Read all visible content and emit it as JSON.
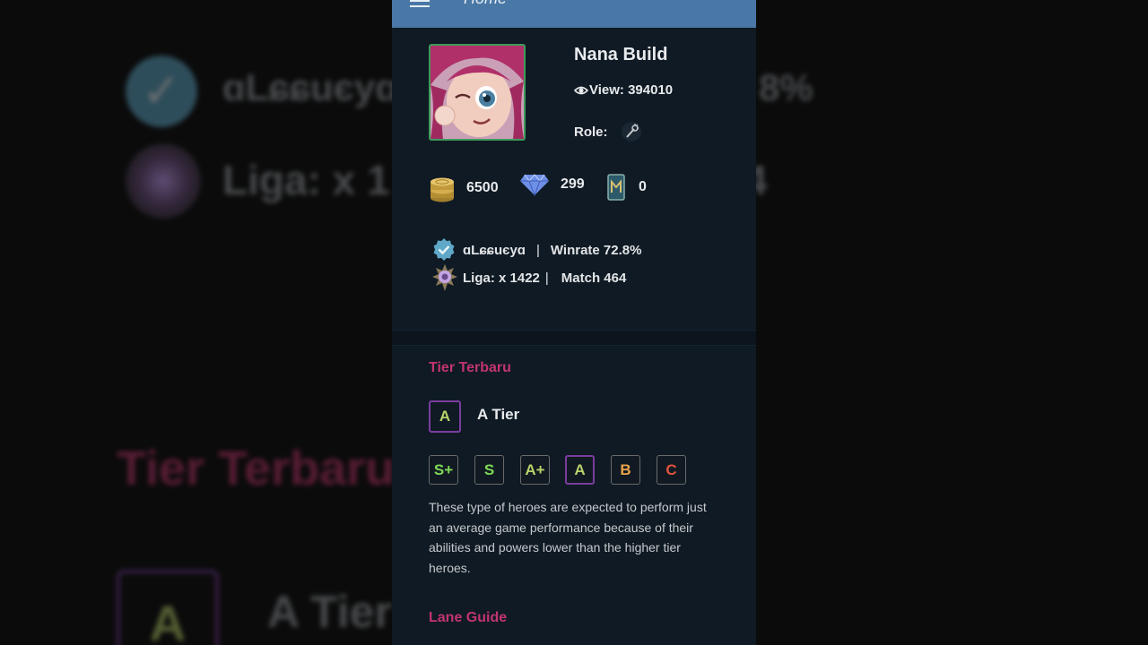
{
  "appbar": {
    "title": "Home"
  },
  "hero": {
    "name": "Nana Build",
    "views_label": "View: 394010",
    "role_label": "Role:"
  },
  "currency": {
    "gold": "6500",
    "diamond": "299",
    "ticket": "0"
  },
  "player": {
    "name": "ɑLɕɕuєyɑ",
    "winrate": "Winrate 72.8%",
    "league": "Liga: x 1422",
    "separator_1": "|",
    "separator_2": "|",
    "match": "Match 464"
  },
  "tier_section": {
    "title": "Tier Terbaru",
    "current_letter": "A",
    "current_label": "A Tier",
    "tiers": [
      {
        "label": "S+",
        "color": "#7ed957"
      },
      {
        "label": "S",
        "color": "#7ed957"
      },
      {
        "label": "A+",
        "color": "#b8d36a"
      },
      {
        "label": "A",
        "color": "#b8d36a"
      },
      {
        "label": "B",
        "color": "#e8a34a"
      },
      {
        "label": "C",
        "color": "#e0543c"
      }
    ],
    "description": "These type of heroes are expected to perform just an average game performance because of their abilities and powers lower than the higher tier heroes."
  },
  "lane_section": {
    "title": "Lane Guide"
  },
  "backdrop": {
    "player": "ɑLɕɕuєyɑ",
    "winrate_fragment": "8%",
    "league_fragment": "Liga: x 1",
    "league_tail": "4",
    "tier_title": "Tier Terbaru",
    "tier_letter": "A",
    "tier_label": "A Tier"
  },
  "icons": {
    "menu": "hamburger-menu-icon",
    "eye": "eye-icon",
    "role": "support-wand-icon",
    "gold": "gold-coins-icon",
    "diamond": "diamond-icon",
    "ticket": "ticket-card-icon",
    "verified": "verified-badge-icon",
    "league": "league-medal-icon"
  },
  "colors": {
    "appbar": "#4a78a6",
    "panel": "#0f1a24",
    "accent_pink": "#c2356e",
    "tier_border": "#7a3d9e"
  }
}
